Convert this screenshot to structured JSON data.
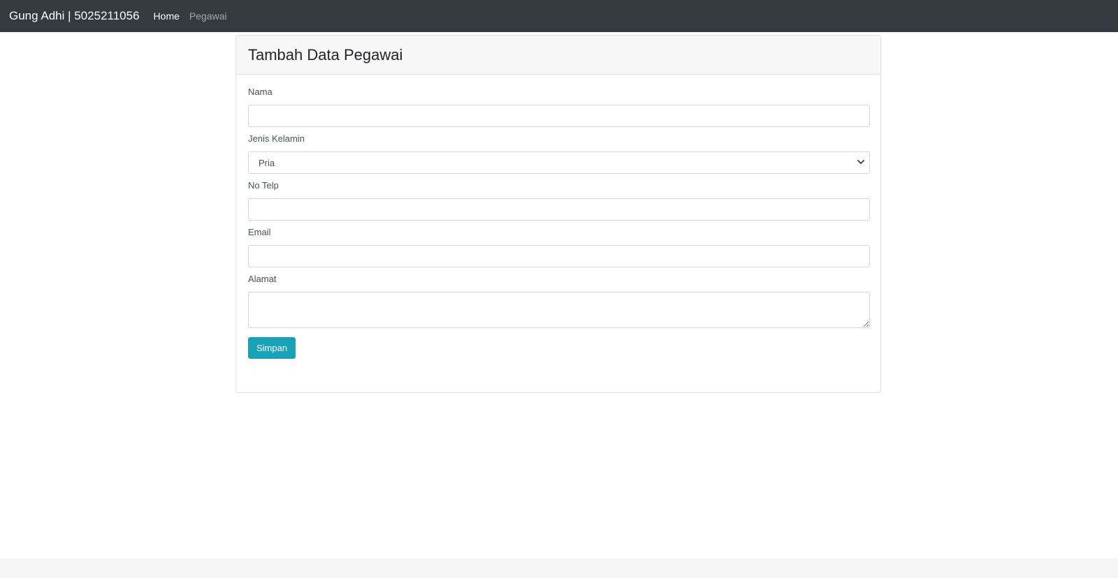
{
  "navbar": {
    "brand": "Gung Adhi | 5025211056",
    "links": [
      {
        "label": "Home"
      },
      {
        "label": "Pegawai"
      }
    ]
  },
  "form": {
    "title": "Tambah Data Pegawai",
    "fields": {
      "nama": {
        "label": "Nama",
        "value": ""
      },
      "jenis_kelamin": {
        "label": "Jenis Kelamin",
        "selected": "Pria"
      },
      "no_telp": {
        "label": "No Telp",
        "value": ""
      },
      "email": {
        "label": "Email",
        "value": ""
      },
      "alamat": {
        "label": "Alamat",
        "value": ""
      }
    },
    "submit_label": "Simpan"
  },
  "colors": {
    "navbar_bg": "#343a40",
    "button_bg": "#17a2b8",
    "card_header_bg": "#f7f7f7"
  },
  "icons": {
    "select_arrow": "chevron-down-icon"
  }
}
